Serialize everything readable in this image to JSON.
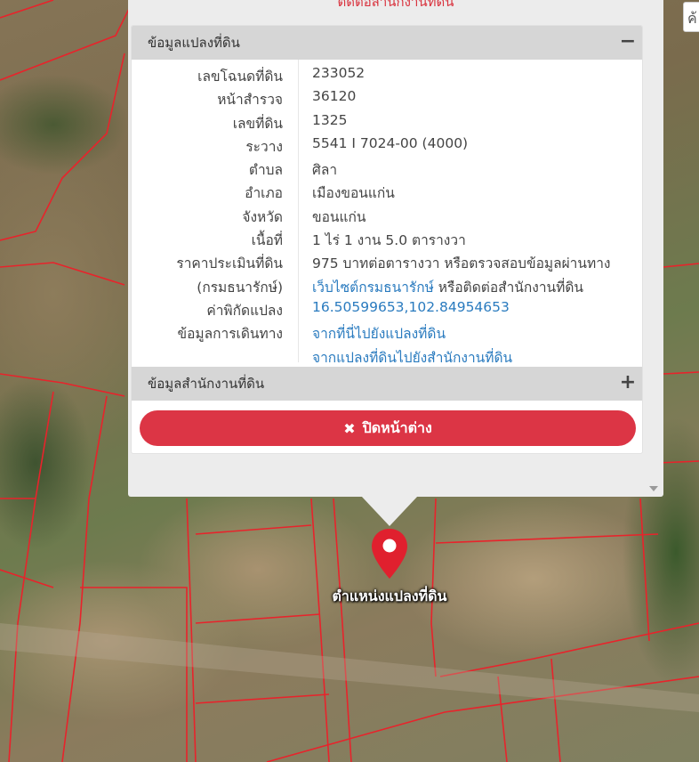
{
  "popup": {
    "top_text": "ติดต่อสำนักงานที่ดิน",
    "section1": {
      "title": "ข้อมูลแปลงที่ดิน",
      "toggle": "−"
    },
    "rows": [
      {
        "label": "เลขโฉนดที่ดิน",
        "value": "233052"
      },
      {
        "label": "หน้าสำรวจ",
        "value": "36120"
      },
      {
        "label": "เลขที่ดิน",
        "value": "1325"
      },
      {
        "label": "ระวาง",
        "value": "5541 I 7024-00 (4000)"
      },
      {
        "label": "ตำบล",
        "value": "ศิลา"
      },
      {
        "label": "อำเภอ",
        "value": "เมืองขอนแก่น"
      },
      {
        "label": "จังหวัด",
        "value": "ขอนแก่น"
      },
      {
        "label": "เนื้อที่",
        "value": "1 ไร่ 1 งาน 5.0 ตารางวา"
      },
      {
        "label": "ราคาประเมินที่ดิน",
        "value": "975 บาทต่อตารางวา หรือตรวจสอบข้อมูลผ่านทาง"
      },
      {
        "label": "(กรมธนารักษ์)",
        "link": "เว็บไซต์กรมธนารักษ์",
        "value_suffix": " หรือติดต่อสำนักงานที่ดิน"
      },
      {
        "label": "ค่าพิกัดแปลง",
        "link": "16.50599653,102.84954653"
      },
      {
        "label": "ข้อมูลการเดินทาง",
        "link": "จากที่นี่ไปยังแปลงที่ดิน"
      },
      {
        "label": "",
        "link": "จากแปลงที่ดินไปยังสำนักงานที่ดิน"
      }
    ],
    "section2": {
      "title": "ข้อมูลสำนักงานที่ดิน",
      "toggle": "+"
    },
    "close_label": "ปิดหน้าต่าง",
    "close_icon": "✖"
  },
  "map": {
    "marker_label": "ตำแหน่งแปลงที่ดิน",
    "marker_color": "#e0202e",
    "search_stub": "ค้"
  }
}
